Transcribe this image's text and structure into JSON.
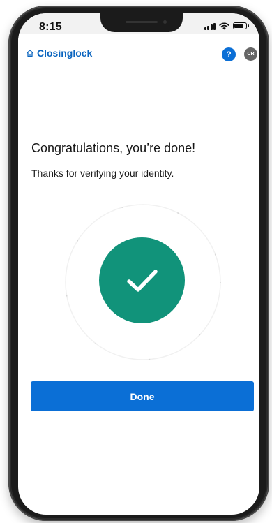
{
  "status_bar": {
    "time": "8:15"
  },
  "header": {
    "brand": "Closinglock",
    "help_label": "?",
    "avatar_initials": "CR"
  },
  "main": {
    "heading": "Congratulations, you’re done!",
    "message": "Thanks for verifying your identity.",
    "done_label": "Done"
  },
  "icons": {
    "home": "home-icon",
    "check": "checkmark-icon",
    "signal": "cellular-signal-icon",
    "wifi": "wifi-icon",
    "battery": "battery-icon"
  },
  "colors": {
    "brand": "#0b65bf",
    "primary_button": "#0b6fd6",
    "success": "#11937a",
    "avatar": "#666666"
  }
}
